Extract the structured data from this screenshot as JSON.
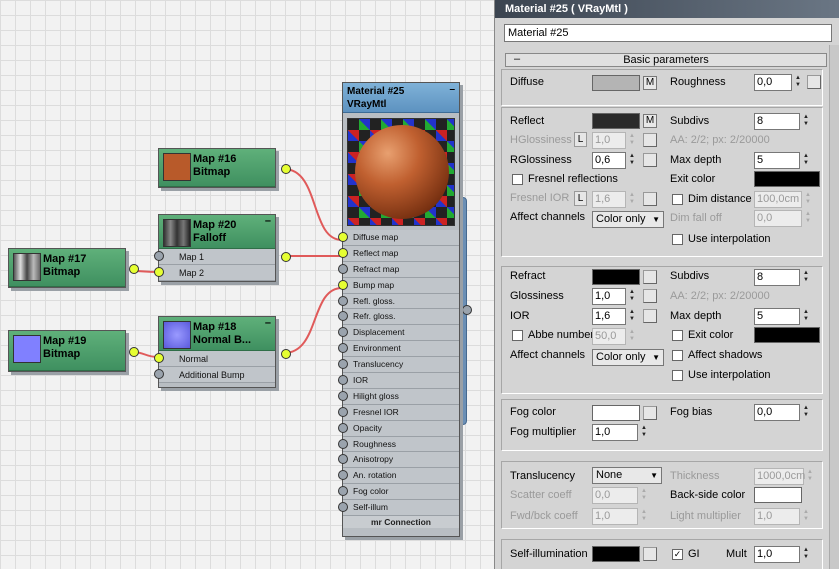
{
  "nodes": {
    "map16": {
      "name": "Map #16",
      "type": "Bitmap",
      "thumb_color": "#b85a2a"
    },
    "map20": {
      "name": "Map #20",
      "type": "Falloff",
      "slots": [
        "Map 1",
        "Map 2"
      ]
    },
    "map17": {
      "name": "Map #17",
      "type": "Bitmap"
    },
    "map18": {
      "name": "Map #18",
      "type": "Normal B...",
      "slots": [
        "Normal",
        "Additional Bump"
      ]
    },
    "map19": {
      "name": "Map #19",
      "type": "Bitmap",
      "thumb_color": "#8080ff"
    },
    "material": {
      "name": "Material #25",
      "type": "VRayMtl",
      "slots": [
        "Diffuse map",
        "Reflect map",
        "Refract map",
        "Bump map",
        "Refl. gloss.",
        "Refr. gloss.",
        "Displacement",
        "Environment",
        "Translucency",
        "IOR",
        "Hilight gloss",
        "Fresnel IOR",
        "Opacity",
        "Roughness",
        "Anisotropy",
        "An. rotation",
        "Fog color",
        "Self-illum"
      ],
      "footer": "mr Connection"
    }
  },
  "panel": {
    "title": "Material #25  ( VRayMtl )",
    "material_name": "Material #25",
    "rollout_title": "Basic parameters",
    "rollout_toggle": "–",
    "m_label": "M",
    "l_label": "L",
    "diffuse": {
      "label": "Diffuse",
      "color": "#b4b4b4",
      "roughness_label": "Roughness",
      "roughness": "0,0"
    },
    "reflect": {
      "label": "Reflect",
      "color": "#2a2a2a",
      "subdivs_label": "Subdivs",
      "subdivs": "8",
      "hgloss_label": "HGlossiness",
      "hgloss": "1,0",
      "aa_text": "AA: 2/2; px: 2/20000",
      "rgloss_label": "RGlossiness",
      "rgloss": "0,6",
      "maxdepth_label": "Max depth",
      "maxdepth": "5",
      "fresnel_label": "Fresnel reflections",
      "exit_label": "Exit color",
      "exit_color": "#000000",
      "fresnel_ior_label": "Fresnel IOR",
      "fresnel_ior": "1,6",
      "dim_label": "Dim distance",
      "dim": "100,0cm",
      "dimfall_label": "Dim fall off",
      "dimfall": "0,0",
      "affect_label": "Affect channels",
      "affect": "Color only",
      "interp_label": "Use interpolation"
    },
    "refract": {
      "label": "Refract",
      "color": "#000000",
      "subdivs_label": "Subdivs",
      "subdivs": "8",
      "gloss_label": "Glossiness",
      "gloss": "1,0",
      "aa_text": "AA: 2/2; px: 2/20000",
      "ior_label": "IOR",
      "ior": "1,6",
      "maxdepth_label": "Max depth",
      "maxdepth": "5",
      "abbe_label": "Abbe number",
      "abbe": "50,0",
      "exit_label": "Exit color",
      "exit_color": "#000000",
      "affect_label": "Affect channels",
      "affect": "Color only",
      "shadows_label": "Affect shadows",
      "interp_label": "Use interpolation"
    },
    "fog": {
      "color_label": "Fog color",
      "color": "#ffffff",
      "bias_label": "Fog bias",
      "bias": "0,0",
      "mult_label": "Fog multiplier",
      "mult": "1,0"
    },
    "translucency": {
      "label": "Translucency",
      "value": "None",
      "thickness_label": "Thickness",
      "thickness": "1000,0cm",
      "scatter_label": "Scatter coeff",
      "scatter": "0,0",
      "backside_label": "Back-side color",
      "backside_color": "#ffffff",
      "fwd_label": "Fwd/bck coeff",
      "fwd": "1,0",
      "light_label": "Light multiplier",
      "light": "1,0"
    },
    "selfillum": {
      "label": "Self-illumination",
      "color": "#000000",
      "gi_label": "GI",
      "gi_checked": "✓",
      "mult_label": "Mult",
      "mult": "1,0"
    }
  }
}
